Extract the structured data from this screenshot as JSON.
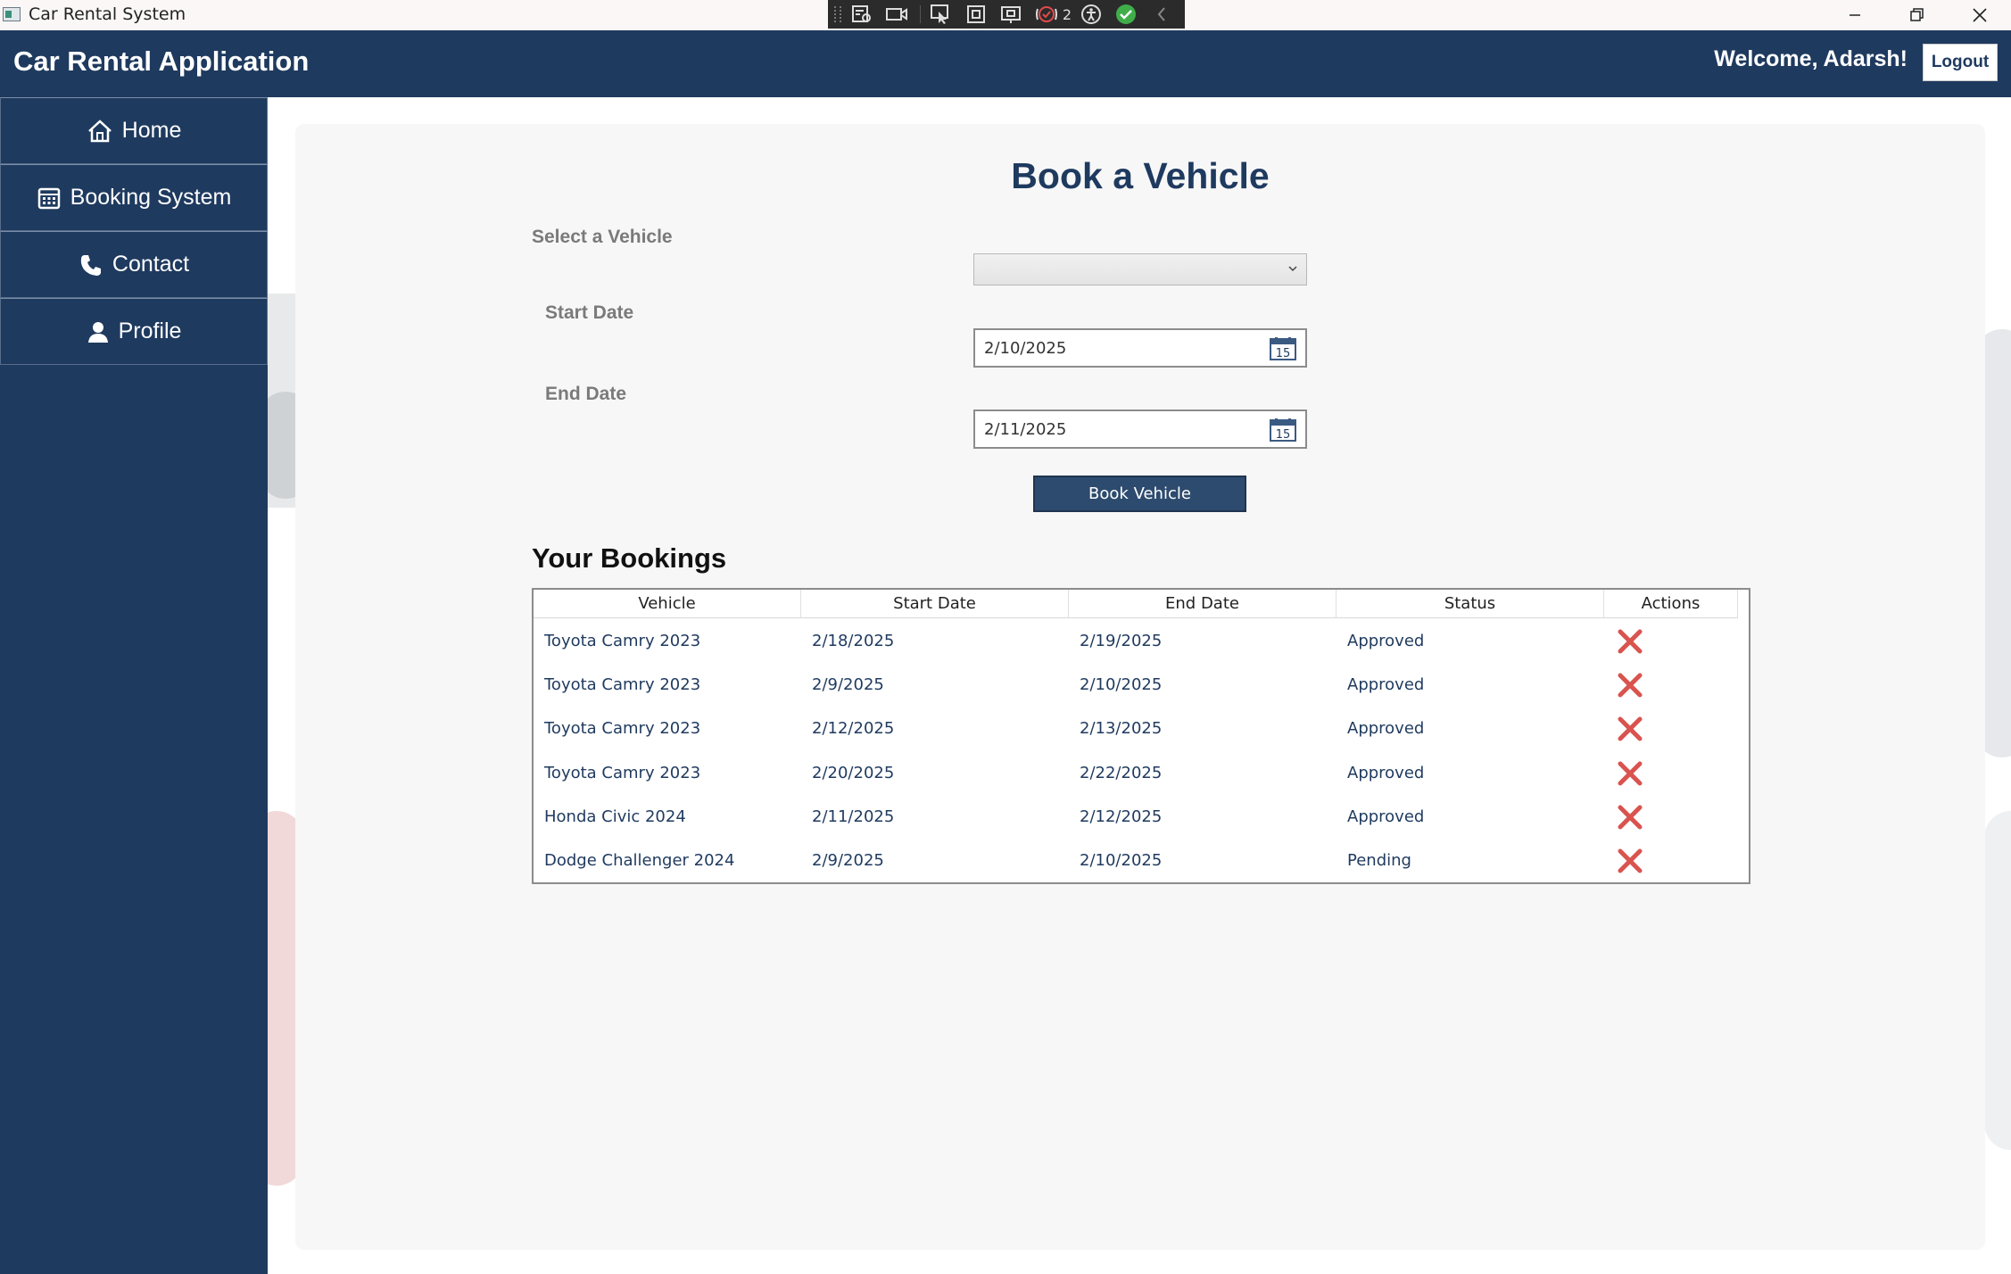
{
  "window": {
    "title": "Car Rental System",
    "devtools_badge_count": "2"
  },
  "header": {
    "app_name": "Car Rental Application",
    "welcome": "Welcome, Adarsh!",
    "logout_label": "Logout"
  },
  "sidebar": {
    "items": [
      {
        "label": "Home",
        "icon": "home-icon"
      },
      {
        "label": "Booking System",
        "icon": "calendar-icon"
      },
      {
        "label": "Contact",
        "icon": "phone-icon"
      },
      {
        "label": "Profile",
        "icon": "user-icon"
      }
    ]
  },
  "form": {
    "title": "Book a Vehicle",
    "vehicle_label": "Select a Vehicle",
    "vehicle_value": "",
    "start_label": "Start Date",
    "start_value": "2/10/2025",
    "end_label": "End Date",
    "end_value": "2/11/2025",
    "submit_label": "Book Vehicle",
    "calendar_icon_day": "15"
  },
  "bookings": {
    "title": "Your Bookings",
    "columns": [
      "Vehicle",
      "Start Date",
      "End Date",
      "Status",
      "Actions"
    ],
    "rows": [
      {
        "vehicle": "Toyota Camry 2023",
        "start": "2/18/2025",
        "end": "2/19/2025",
        "status": "Approved"
      },
      {
        "vehicle": "Toyota Camry 2023",
        "start": "2/9/2025",
        "end": "2/10/2025",
        "status": "Approved"
      },
      {
        "vehicle": "Toyota Camry 2023",
        "start": "2/12/2025",
        "end": "2/13/2025",
        "status": "Approved"
      },
      {
        "vehicle": "Toyota Camry 2023",
        "start": "2/20/2025",
        "end": "2/22/2025",
        "status": "Approved"
      },
      {
        "vehicle": "Honda Civic 2024",
        "start": "2/11/2025",
        "end": "2/12/2025",
        "status": "Approved"
      },
      {
        "vehicle": "Dodge Challenger 2024",
        "start": "2/9/2025",
        "end": "2/10/2025",
        "status": "Pending"
      }
    ]
  },
  "colors": {
    "primary": "#1f3a5f",
    "button": "#2d4b6e",
    "delete": "#d9534f",
    "panel": "#f7f7f7"
  }
}
